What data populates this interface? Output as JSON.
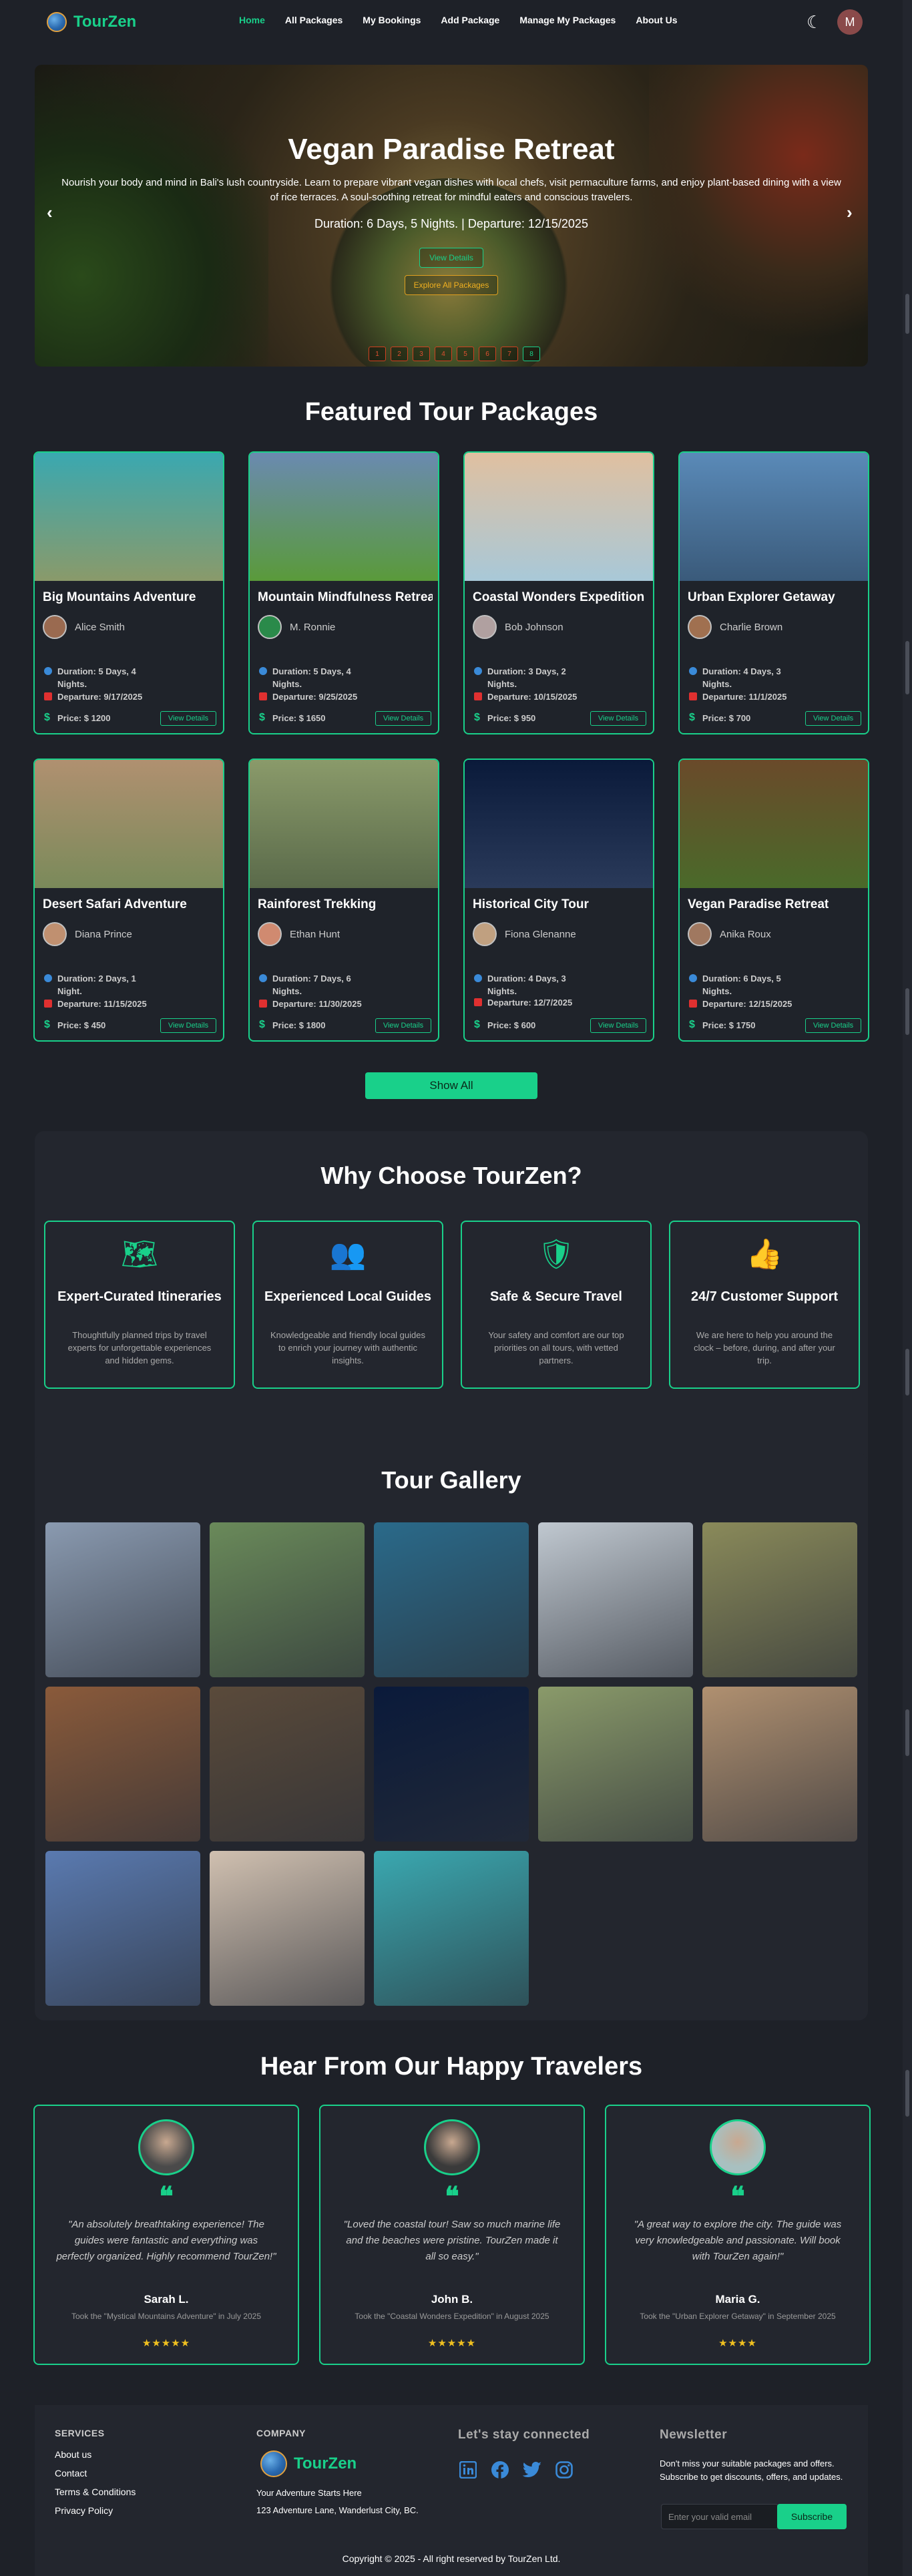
{
  "nav": {
    "brand": "TourZen",
    "links": [
      "Home",
      "All Packages",
      "My Bookings",
      "Add Package",
      "Manage My Packages",
      "About Us"
    ],
    "active": "Home",
    "avatar_letter": "M"
  },
  "hero": {
    "title": "Vegan Paradise Retreat",
    "description": "Nourish your body and mind in Bali's lush countryside. Learn to prepare vibrant vegan dishes with local chefs, visit permaculture farms, and enjoy plant-based dining with a view of rice terraces. A soul-soothing retreat for mindful eaters and conscious travelers.",
    "meta": "Duration: 6 Days, 5 Nights. | Departure: 12/15/2025",
    "view_details": "View Details",
    "explore": "Explore All Packages",
    "prev": "‹",
    "next": "›",
    "dots": [
      "1",
      "2",
      "3",
      "4",
      "5",
      "6",
      "7",
      "8"
    ],
    "active_dot": 8
  },
  "featured": {
    "heading": "Featured Tour Packages",
    "button_label": "View Details",
    "packages": [
      {
        "title": "Big Mountains Adventure",
        "author": "Alice Smith",
        "duration": "Duration: 5 Days, 4 Nights.",
        "departure": "Departure: 9/17/2025",
        "price": "Price: $ 1200",
        "img": "#3aa8b0",
        "img2": "#8a9a6a"
      },
      {
        "title": "Mountain Mindfulness Retreat",
        "author": "M. Ronnie",
        "duration": "Duration: 5 Days, 4 Nights.",
        "departure": "Departure: 9/25/2025",
        "price": "Price: $ 1650",
        "img": "#6a8ab0",
        "img2": "#5a9a3a"
      },
      {
        "title": "Coastal Wonders Expedition",
        "author": "Bob Johnson",
        "duration": "Duration: 3 Days, 2 Nights.",
        "departure": "Departure: 10/15/2025",
        "price": "Price: $ 950",
        "img": "#e0c0a0",
        "img2": "#a8c8d8"
      },
      {
        "title": "Urban Explorer Getaway",
        "author": "Charlie Brown",
        "duration": "Duration: 4 Days, 3 Nights.",
        "departure": "Departure: 11/1/2025",
        "price": "Price: $ 700",
        "img": "#5a8ab8",
        "img2": "#3a5a7a"
      },
      {
        "title": "Desert Safari Adventure",
        "author": "Diana Prince",
        "duration": "Duration: 2 Days, 1 Night.",
        "departure": "Departure: 11/15/2025",
        "price": "Price: $ 450",
        "img": "#b09070",
        "img2": "#7a8a5a"
      },
      {
        "title": "Rainforest Trekking",
        "author": "Ethan Hunt",
        "duration": "Duration: 7 Days, 6 Nights.",
        "departure": "Departure: 11/30/2025",
        "price": "Price: $ 1800",
        "img": "#8a9a6a",
        "img2": "#5a6a4a"
      },
      {
        "title": "Historical City Tour",
        "author": "Fiona Glenanne",
        "duration": "Duration: 4 Days, 3 Nights.",
        "departure": "Departure: 12/7/2025",
        "price": "Price: $ 600",
        "img": "#0a1a3a",
        "img2": "#2a3a5a"
      },
      {
        "title": "Vegan Paradise Retreat",
        "author": "Anika Roux",
        "duration": "Duration: 6 Days, 5 Nights.",
        "departure": "Departure: 12/15/2025",
        "price": "Price: $ 1750",
        "img": "#6a4a2a",
        "img2": "#4a6a2a"
      }
    ],
    "show_all": "Show All"
  },
  "why": {
    "heading": "Why Choose TourZen?",
    "items": [
      {
        "icon": "map-icon",
        "glyph": "🗺",
        "title": "Expert-Curated Itineraries",
        "desc": "Thoughtfully planned trips by travel experts for unforgettable experiences and hidden gems."
      },
      {
        "icon": "users-icon",
        "glyph": "👥",
        "title": "Experienced Local Guides",
        "desc": "Knowledgeable and friendly local guides to enrich your journey with authentic insights."
      },
      {
        "icon": "shield-icon",
        "glyph": "🛡",
        "title": "Safe & Secure Travel",
        "desc": "Your safety and comfort are our top priorities on all tours, with vetted partners."
      },
      {
        "icon": "thumbs-up-icon",
        "glyph": "👍",
        "title": "24/7 Customer Support",
        "desc": "We are here to help you around the clock – before, during, and after your trip."
      }
    ]
  },
  "gallery": {
    "heading": "Tour Gallery",
    "images": [
      "#8a9ab0",
      "#6a8a5a",
      "#2a6a8a",
      "#c0c8d0",
      "#8a8a5a",
      "#8a5a3a",
      "#5a4a3a",
      "#0a1a3a",
      "#8a9a6a",
      "#b09070",
      "#5a7ab0",
      "#d0c0b0",
      "#3aa8b0"
    ]
  },
  "testimonials": {
    "heading": "Hear From Our Happy Travelers",
    "items": [
      {
        "quote": "\"An absolutely breathtaking experience! The guides were fantastic and everything was perfectly organized. Highly recommend TourZen!\"",
        "name": "Sarah L.",
        "trip": "Took the \"Mystical Mountains Adventure\" in July 2025",
        "stars": "★★★★★",
        "avatar": "#4a4a4a"
      },
      {
        "quote": "\"Loved the coastal tour! Saw so much marine life and the beaches were pristine. TourZen made it all so easy.\"",
        "name": "John B.",
        "trip": "Took the \"Coastal Wonders Expedition\" in August 2025",
        "stars": "★★★★★",
        "avatar": "#3a3a3a"
      },
      {
        "quote": "\"A great way to explore the city. The guide was very knowledgeable and passionate. Will book with TourZen again!\"",
        "name": "Maria G.",
        "trip": "Took the \"Urban Explorer Getaway\" in September 2025",
        "stars": "★★★★",
        "avatar": "#a8c0c0"
      }
    ]
  },
  "footer": {
    "services_head": "SERVICES",
    "services": [
      "About us",
      "Contact",
      "Terms & Conditions",
      "Privacy Policy"
    ],
    "company_head": "COMPANY",
    "brand": "TourZen",
    "tagline": "Your Adventure Starts Here",
    "address": "123 Adventure Lane, Wanderlust City, BC.",
    "connected_head": "Let's stay connected",
    "newsletter_head": "Newsletter",
    "newsletter_desc": "Don't miss your suitable packages and offers. Subscribe to get discounts, offers, and updates.",
    "email_placeholder": "Enter your valid email",
    "subscribe": "Subscribe",
    "copyright": "Copyright © 2025 - All right reserved by TourZen Ltd."
  }
}
